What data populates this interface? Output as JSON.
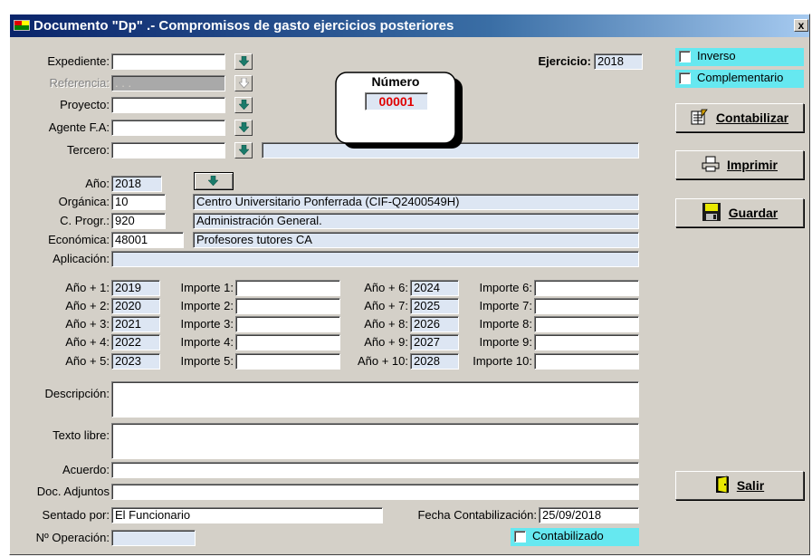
{
  "window": {
    "title": "Documento \"Dp\" .-  Compromisos de gasto ejercicios posteriores",
    "close_label": "x"
  },
  "header": {
    "expediente_label": "Expediente:",
    "expediente_value": "",
    "referencia_label": "Referencia:",
    "referencia_value": ". . .",
    "proyecto_label": "Proyecto:",
    "proyecto_value": "",
    "agente_label": "Agente F.A:",
    "agente_value": "",
    "tercero_label": "Tercero:",
    "tercero_value": "",
    "tercero_name": "",
    "ejercicio_label": "Ejercicio:",
    "ejercicio_value": "2018",
    "numero_label": "Número",
    "numero_value": "00001"
  },
  "budget": {
    "anio_label": "Año:",
    "anio_value": "2018",
    "organica_label": "Orgánica:",
    "organica_value": "10",
    "organica_desc": "Centro Universitario Ponferrada (CIF-Q2400549H)",
    "cprogr_label": "C. Progr.:",
    "cprogr_value": "920",
    "cprogr_desc": "Administración General.",
    "economica_label": "Económica:",
    "economica_value": "48001",
    "economica_desc": "Profesores tutores CA",
    "aplicacion_label": "Aplicación:",
    "aplicacion_value": ""
  },
  "years": [
    {
      "anio_label": "Año + 1:",
      "anio": "2019",
      "importe_label": "Importe 1:",
      "importe": ""
    },
    {
      "anio_label": "Año + 2:",
      "anio": "2020",
      "importe_label": "Importe 2:",
      "importe": ""
    },
    {
      "anio_label": "Año + 3:",
      "anio": "2021",
      "importe_label": "Importe 3:",
      "importe": ""
    },
    {
      "anio_label": "Año + 4:",
      "anio": "2022",
      "importe_label": "Importe 4:",
      "importe": ""
    },
    {
      "anio_label": "Año + 5:",
      "anio": "2023",
      "importe_label": "Importe 5:",
      "importe": ""
    },
    {
      "anio_label": "Año + 6:",
      "anio": "2024",
      "importe_label": "Importe 6:",
      "importe": ""
    },
    {
      "anio_label": "Año + 7:",
      "anio": "2025",
      "importe_label": "Importe 7:",
      "importe": ""
    },
    {
      "anio_label": "Año + 8:",
      "anio": "2026",
      "importe_label": "Importe 8:",
      "importe": ""
    },
    {
      "anio_label": "Año + 9:",
      "anio": "2027",
      "importe_label": "Importe 9:",
      "importe": ""
    },
    {
      "anio_label": "Año + 10:",
      "anio": "2028",
      "importe_label": "Importe 10:",
      "importe": ""
    }
  ],
  "details": {
    "descripcion_label": "Descripción:",
    "descripcion_value": "",
    "texto_label": "Texto libre:",
    "texto_value": "",
    "acuerdo_label": "Acuerdo:",
    "acuerdo_value": "",
    "adjuntos_label": "Doc. Adjuntos",
    "adjuntos_value": "",
    "sentado_label": "Sentado por:",
    "sentado_value": "El Funcionario",
    "fecha_label": "Fecha Contabilización:",
    "fecha_value": "25/09/2018",
    "noperacion_label": "Nº Operación:",
    "noperacion_value": "",
    "contabilizado_label": "Contabilizado",
    "contabilizado_checked": false
  },
  "side": {
    "inverso_label": "Inverso",
    "inverso_checked": false,
    "complementario_label": "Complementario",
    "complementario_checked": false,
    "contabilizar_label": "Contabilizar",
    "imprimir_label": "Imprimir",
    "guardar_label": "Guardar",
    "salir_label": "Salir"
  },
  "icons": {
    "lookup": "down-arrow-icon",
    "contabilizar": "ledger-icon",
    "imprimir": "printer-icon",
    "guardar": "floppy-disk-icon",
    "salir": "exit-door-icon"
  },
  "colors": {
    "field_blue": "#dde6f3",
    "check_cyan": "#66e8f0",
    "number_red": "#e00000",
    "arrow_green": "#1a7a6a",
    "titlebar": "#0a246a"
  }
}
